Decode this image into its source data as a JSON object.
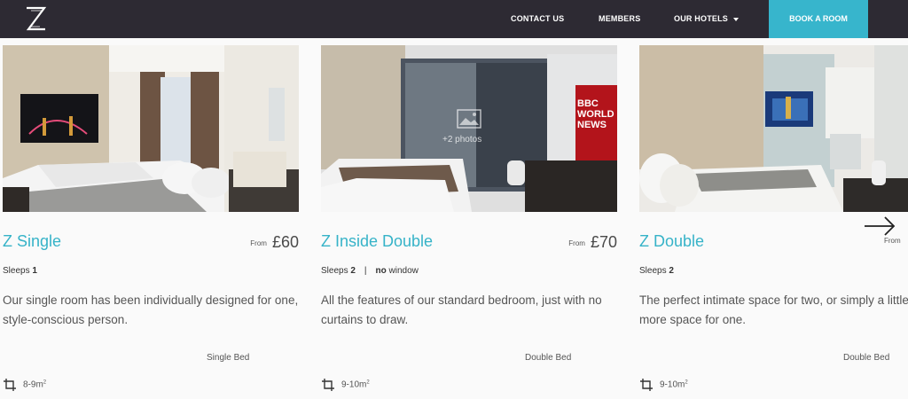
{
  "header": {
    "logo_letter": "Z",
    "nav": [
      {
        "label": "CONTACT US"
      },
      {
        "label": "MEMBERS"
      },
      {
        "label": "OUR HOTELS"
      }
    ],
    "book_label": "BOOK A ROOM"
  },
  "rooms": [
    {
      "name": "Z Single",
      "from": "From",
      "price": "£60",
      "sleeps_label": "Sleeps",
      "sleeps": "1",
      "description": "Our single room has been individually designed for one, style-conscious person.",
      "bed": "Single Bed",
      "size": "8-9m",
      "size_unit": "2"
    },
    {
      "name": "Z Inside Double",
      "from": "From",
      "price": "£70",
      "sleeps_label": "Sleeps",
      "sleeps": "2",
      "separator": "|",
      "extra_bold": "no",
      "extra_text": "window",
      "description": "All the features of our standard bedroom, just with no curtains to draw.",
      "bed": "Double Bed",
      "size": "9-10m",
      "size_unit": "2",
      "photo_overlay": "+2 photos",
      "tv_text": "BBC WORLD NEWS"
    },
    {
      "name": "Z Double",
      "from": "From",
      "sleeps_label": "Sleeps",
      "sleeps": "2",
      "description": "The perfect intimate space for two, or simply a little more space for one.",
      "bed": "Double Bed",
      "size": "9-10m",
      "size_unit": "2"
    }
  ],
  "colors": {
    "header_bg": "#2d2a33",
    "accent": "#37b5cc",
    "room_title": "#36b3c8"
  },
  "icons": [
    "z-logo",
    "chevron-down-icon",
    "next-arrow-icon",
    "room-size-icon",
    "photo-gallery-icon"
  ]
}
